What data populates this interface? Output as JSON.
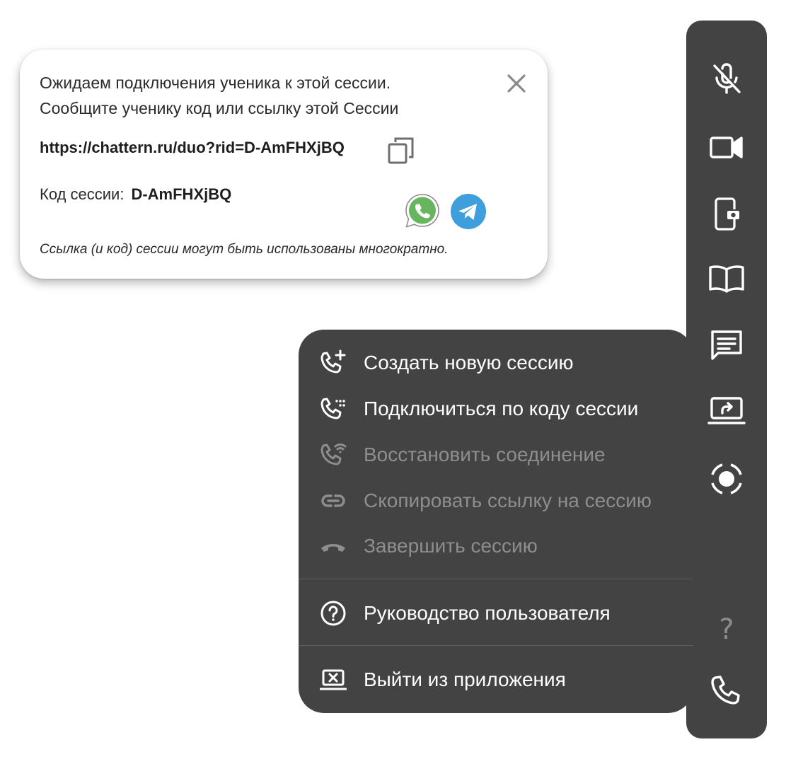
{
  "invite": {
    "line1": "Ожидаем подключения ученика к этой сессии.",
    "line2": "Сообщите ученику код или ссылку этой Сессии",
    "link": "https://chattern.ru/duo?rid=D-AmFHXjBQ",
    "code_label": "Код сессии:",
    "code_value": "D-AmFHXjBQ",
    "note": "Ссылка (и код) сессии могут быть использованы многократно.",
    "close_icon": "close-icon",
    "copy_icon": "copy-icon",
    "share_icons": [
      "whatsapp-icon",
      "telegram-icon"
    ]
  },
  "toolbar": {
    "icons": [
      "mic-off-icon",
      "camera-icon",
      "phone-camera-icon",
      "book-icon",
      "chat-icon",
      "screen-share-icon",
      "record-icon",
      "help-icon",
      "phone-icon"
    ],
    "help_mark": "?"
  },
  "menu": {
    "items": [
      {
        "label": "Создать новую сессию",
        "icon": "phone-add-icon",
        "enabled": true
      },
      {
        "label": "Подключиться по коду сессии",
        "icon": "phone-dialpad-icon",
        "enabled": true
      },
      {
        "label": "Восстановить соединение",
        "icon": "phone-wifi-icon",
        "enabled": false
      },
      {
        "label": "Скопировать ссылку на сессию",
        "icon": "link-icon",
        "enabled": false
      },
      {
        "label": "Завершить сессию",
        "icon": "call-end-icon",
        "enabled": false
      }
    ],
    "help_label": "Руководство пользователя",
    "exit_label": "Выйти из приложения"
  },
  "colors": {
    "panel": "#434343",
    "text_light": "#ffffff",
    "text_disabled": "#8e8e8e",
    "whatsapp": "#65b95f",
    "telegram": "#3f9fdc"
  }
}
